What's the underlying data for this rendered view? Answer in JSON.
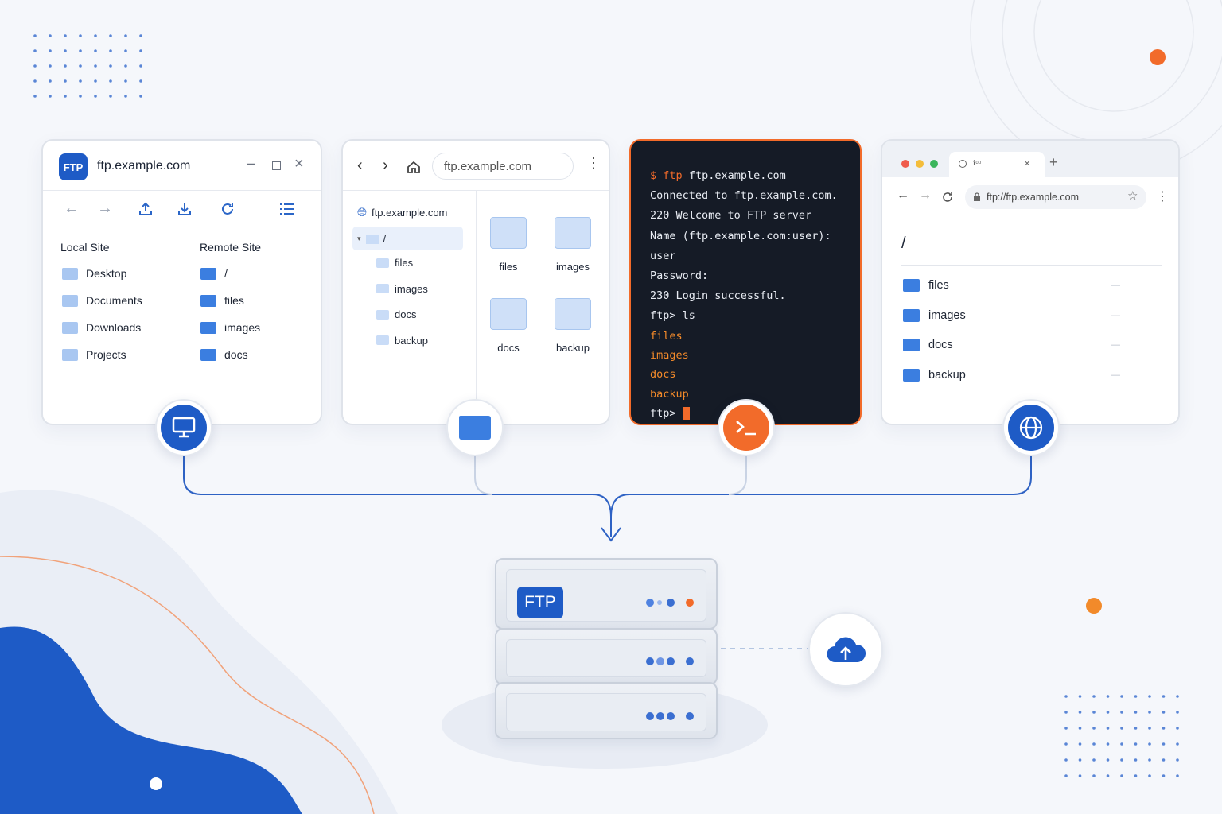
{
  "colors": {
    "primary": "#1e5bc6",
    "accent": "#f26b2a",
    "terminal_bg": "#151b26",
    "folder": "#3b7ee0"
  },
  "panel1": {
    "logo_text": "FTP",
    "title": "ftp.example.com",
    "local_header": "Local Site",
    "remote_header": "Remote Site",
    "local_items": [
      "Desktop",
      "Documents",
      "Downloads",
      "Projects"
    ],
    "remote_items": [
      "/",
      "files",
      "images",
      "docs"
    ]
  },
  "panel2": {
    "address": "ftp.example.com",
    "tree_root": "ftp.example.com",
    "tree_slash": "/",
    "tree_items": [
      "files",
      "images",
      "docs",
      "backup"
    ],
    "grid_items": [
      "files",
      "images",
      "docs",
      "backup"
    ]
  },
  "terminal": {
    "prompt": "$",
    "cmd": "ftp",
    "host": "ftp.example.com",
    "lines": [
      "Connected to ftp.example.com.",
      "220 Welcome to FTP server",
      "Name (ftp.example.com:user): user",
      "Password:",
      "230 Login successful.",
      "ftp> ls"
    ],
    "listing": [
      "files",
      "images",
      "docs",
      "backup"
    ],
    "final_prompt": "ftp>"
  },
  "browser": {
    "tab_title": "ℹ︎ᵒᵒ",
    "tab_close": "×",
    "new_tab": "+",
    "url": "ftp://ftp.example.com",
    "path": "/",
    "items": [
      {
        "name": "files",
        "size": "—"
      },
      {
        "name": "images",
        "size": "—"
      },
      {
        "name": "docs",
        "size": "—"
      },
      {
        "name": "backup",
        "size": "—"
      }
    ]
  },
  "server": {
    "label": "FTP"
  }
}
